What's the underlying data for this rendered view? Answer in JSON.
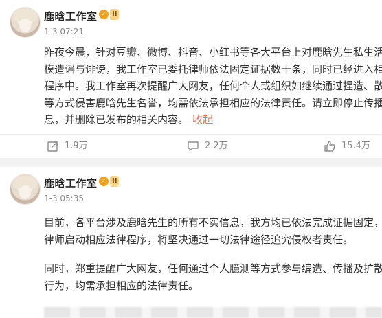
{
  "posts": [
    {
      "author": "鹿晗工作室",
      "vip_badge": "II",
      "time": "1-3 07:21",
      "content_lines": [
        "昨夜今晨，针对豆瓣、微博、抖音、小红书等各大平台上对鹿晗先生私生活",
        "模造谣与诽谤，我工作室已委托律师依法固定证据数十条，同时已经进入相",
        "程序中。我工作室再次提醒广大网友，任何个人或组织如继续通过捏造、散",
        "等方式侵害鹿晗先生名誉，均需依法承担相应的法律责任。请立即停止传播",
        "息，并删除已发布的相关内容。"
      ],
      "collapse_label": "收起",
      "actions": {
        "repost": "1.9万",
        "comment": "2.2万",
        "like": "15.4万"
      }
    },
    {
      "author": "鹿晗工作室",
      "vip_badge": "II",
      "time": "1-3 05:35",
      "content_lines": [
        "目前，各平台涉及鹿晗先生的所有不实信息，我方均已依法完成证据固定，",
        "律师启动相应法律程序，将坚决通过一切法律途径追究侵权者责任。",
        "",
        "同时，郑重提醒广大网友，任何通过个人臆测等方式参与编造、传播及扩散",
        "行为，均需承担相应的法律责任。"
      ]
    }
  ],
  "colors": {
    "accent": "#eb7350",
    "badge": "#f0a31c",
    "separator": "#f2f2f2"
  },
  "icons": [
    "repost-icon",
    "comment-icon",
    "like-icon",
    "verified-icon"
  ]
}
